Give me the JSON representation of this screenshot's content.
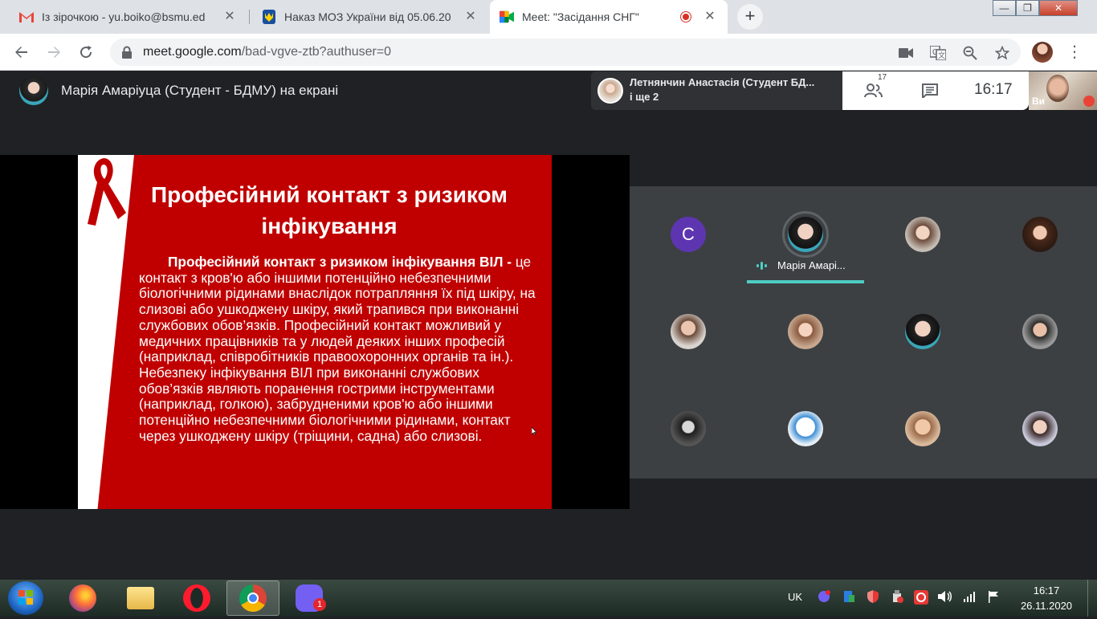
{
  "browser": {
    "tabs": [
      {
        "title": "Із зірочкою - yu.boiko@bsmu.ed",
        "favicon": "gmail-icon",
        "active": false
      },
      {
        "title": "Наказ МОЗ України від 05.06.20",
        "favicon": "trident-icon",
        "active": false
      },
      {
        "title": "Meet: \"Засідання СНГ\"",
        "favicon": "meet-icon",
        "active": true,
        "recording": true
      }
    ],
    "new_tab_label": "+",
    "close_label": "✕",
    "address": {
      "host": "meet.google.com",
      "path": "/bad-vgve-ztb?authuser=0"
    },
    "window_controls": {
      "minimize": "—",
      "restore": "❐",
      "close": "✕"
    }
  },
  "meet": {
    "presenter_text": "Марія Амаріуца (Студент - БДМУ) на екрані",
    "chip": {
      "name": "Летнянчин Анастасія (Студент БД...",
      "more": "і ще 2"
    },
    "participants_count": "17",
    "clock": "16:17",
    "self_label": "Ви",
    "slide": {
      "title": "Професійний контакт з ризиком інфікування",
      "body_bold": "Професійний контакт з ризиком інфікування ВІЛ -",
      "body_text": " це контакт з кров'ю або іншими потенційно небезпечними біологічними рідинами внаслідок потрапляння їх під шкіру, на слизові або ушкоджену шкіру, який трапився при виконанні службових обов’язків. Професійний контакт можливий у медичних працівників та у людей деяких інших професій (наприклад, співробітників правоохоронних органів та ін.). Небезпеку інфікування ВІЛ при виконанні службових обов’язків являють поранення гострими інструментами (наприклад, голкою), забрудненими кров'ю або іншими потенційно небезпечними біологічними рідинами, контакт через ушкоджену шкіру (тріщини, садна) або слизові."
    },
    "grid": [
      {
        "letter": "C",
        "color": "#5e35b1"
      },
      {
        "name": "Марія Амарі...",
        "speaking": true
      },
      {},
      {},
      {},
      {},
      {},
      {},
      {},
      {},
      {},
      {}
    ]
  },
  "taskbar": {
    "apps": [
      "firefox-icon",
      "explorer-icon",
      "opera-icon",
      "chrome-icon",
      "viber-icon"
    ],
    "viber_badge": "1",
    "language": "UK",
    "time": "16:17",
    "date": "26.11.2020"
  },
  "colors": {
    "slide_red": "#c00000",
    "speaking_accent": "#4ecdc4",
    "meet_bg": "#202124"
  }
}
